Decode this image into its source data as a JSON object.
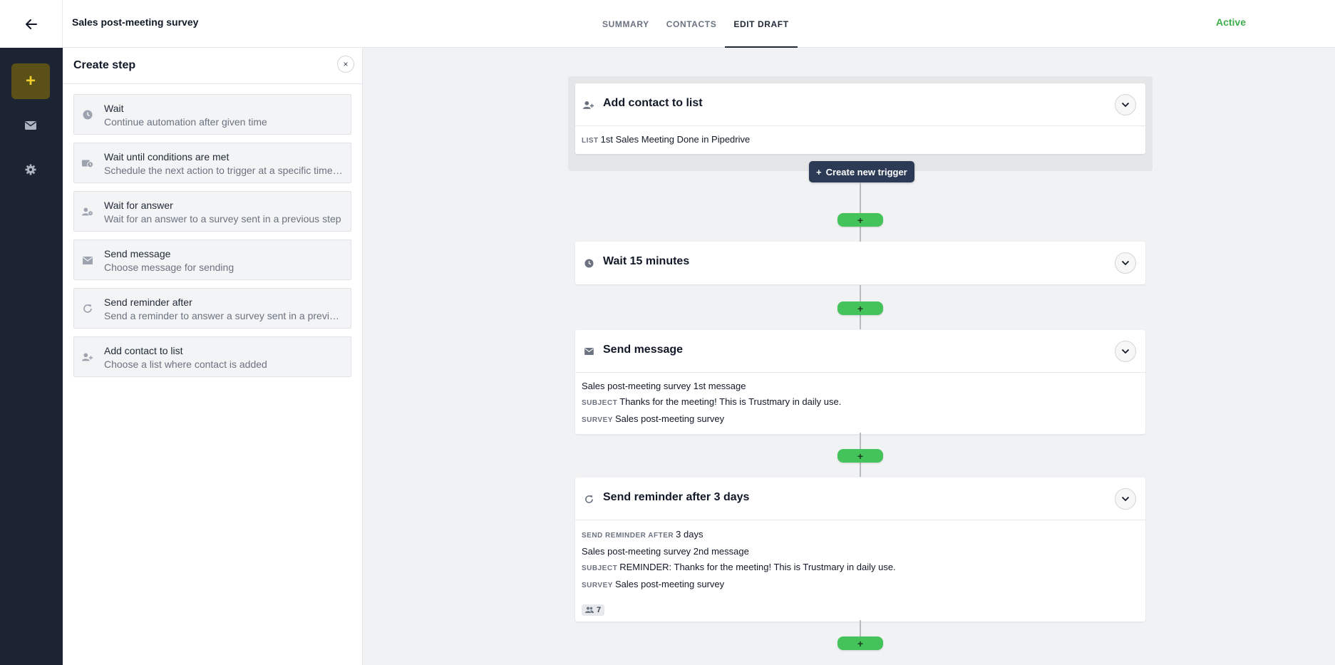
{
  "header": {
    "back_icon": "arrow-left-icon",
    "page_title": "Sales post-meeting survey",
    "tabs": [
      {
        "label": "SUMMARY"
      },
      {
        "label": "CONTACTS"
      },
      {
        "label": "EDIT DRAFT"
      }
    ],
    "active_tab": "EDIT DRAFT",
    "status": "Active",
    "status_color": "#3fae4b"
  },
  "rail": {
    "items": [
      {
        "icon": "plus-icon",
        "label": "+"
      },
      {
        "icon": "mail-icon"
      },
      {
        "icon": "gear-icon"
      }
    ],
    "accent": "#f2cf2a"
  },
  "panel": {
    "title": "Create step",
    "close_label": "×",
    "steps": [
      {
        "name": "Wait",
        "desc": "Continue automation after given time",
        "icon": "clock-icon"
      },
      {
        "name": "Wait until conditions are met",
        "desc": "Schedule the next action to trigger at a specific time or date",
        "icon": "calendar-clock-icon"
      },
      {
        "name": "Wait for answer",
        "desc": "Wait for an answer to a survey sent in a previous step",
        "icon": "user-clock-icon"
      },
      {
        "name": "Send message",
        "desc": "Choose message for sending",
        "icon": "envelope-icon"
      },
      {
        "name": "Send reminder after",
        "desc": "Send a reminder to answer a survey sent in a previous step",
        "icon": "refresh-icon"
      },
      {
        "name": "Add contact to list",
        "desc": "Choose a list where contact is added",
        "icon": "user-plus-icon"
      }
    ]
  },
  "flow": {
    "trigger": {
      "title": "Add contact to list",
      "list_label": "LIST",
      "list_value": "1st Sales Meeting Done in Pipedrive"
    },
    "create_trigger_label": "Create new trigger",
    "add_step_label": "+",
    "wait": {
      "title": "Wait 15 minutes"
    },
    "send_message": {
      "title": "Send message",
      "message_name": "Sales post-meeting survey 1st message",
      "subject_label": "SUBJECT",
      "subject": "Thanks for the meeting! This is Trustmary in daily use.",
      "survey_label": "SURVEY",
      "survey": "Sales post-meeting survey"
    },
    "reminder": {
      "title": "Send reminder after 3 days",
      "after_label": "SEND REMINDER AFTER",
      "after_value": "3 days",
      "message_name": "Sales post-meeting survey 2nd message",
      "subject_label": "SUBJECT",
      "subject": "REMINDER: Thanks for the meeting! This is Trustmary in daily use.",
      "survey_label": "SURVEY",
      "survey": "Sales post-meeting survey",
      "contacts_count": "7"
    }
  },
  "colors": {
    "sidebar_bg": "#1c2332",
    "add_button_green": "#44c35a",
    "trigger_button_bg": "#2d3a55"
  }
}
